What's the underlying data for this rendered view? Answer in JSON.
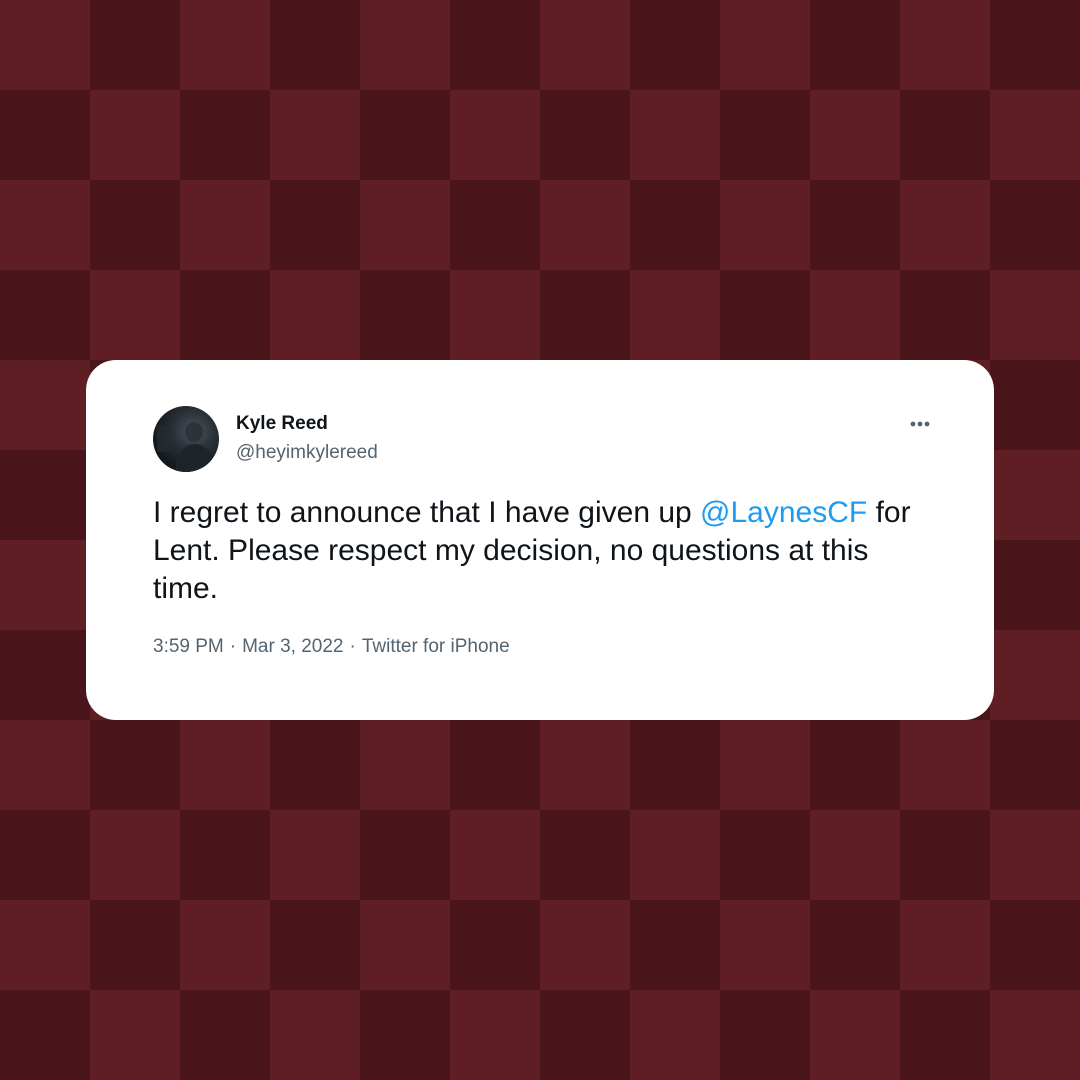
{
  "colors": {
    "background_light": "#5f1d24",
    "background_dark": "#4a151a",
    "card": "#ffffff",
    "text_primary": "#0f1419",
    "text_secondary": "#536471",
    "link": "#1d9bf0"
  },
  "tweet": {
    "author": {
      "name": "Kyle Reed",
      "handle": "@heyimkylereed",
      "avatar_icon": "profile-photo"
    },
    "more_icon": "more-options-icon",
    "text_before_mention": "I regret to announce that I have given up ",
    "mention": "@LaynesCF",
    "text_after_mention": " for Lent. Please respect my decision, no questions at this time.",
    "time": "3:59 PM",
    "date": "Mar 3, 2022",
    "source": "Twitter for iPhone",
    "separator": "·"
  }
}
